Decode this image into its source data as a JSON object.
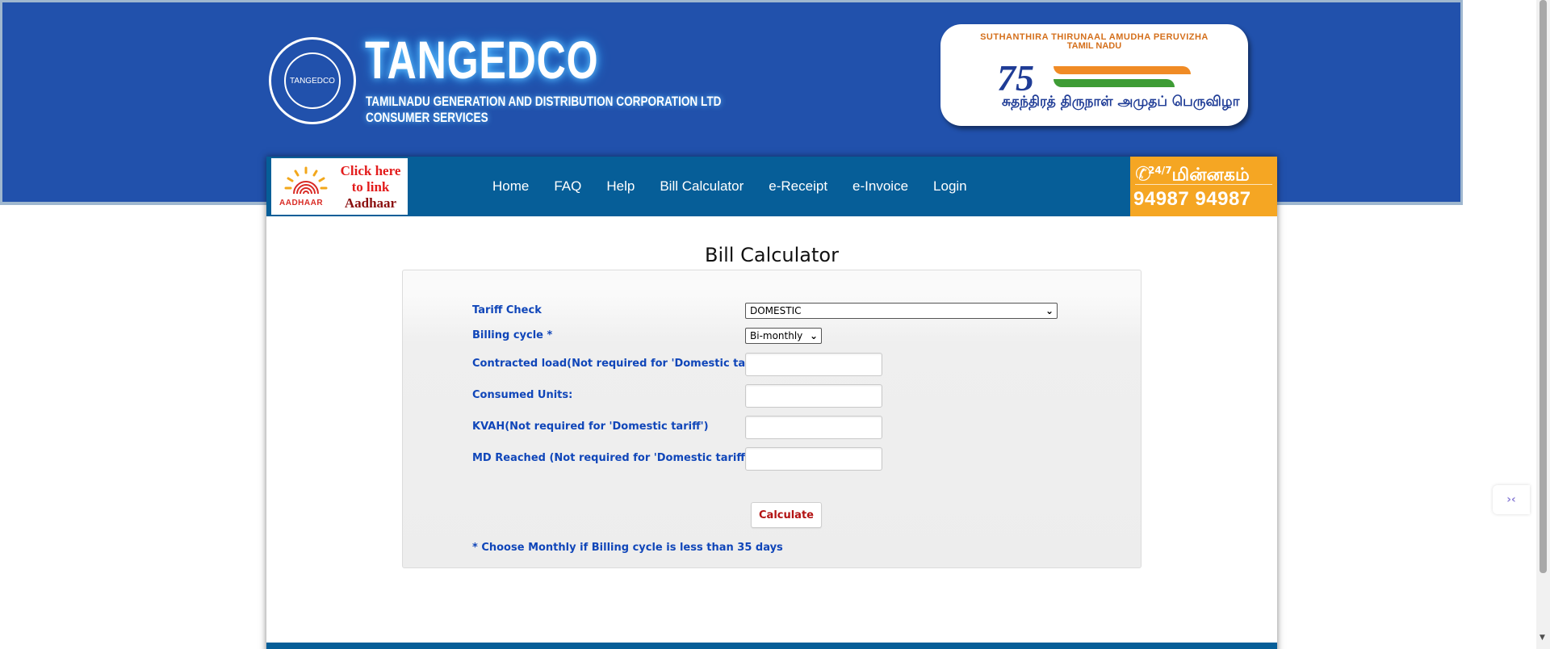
{
  "header": {
    "logo_text": "TANGEDCO",
    "brand_title": "TANGEDCO",
    "brand_subtitle_line1": "TAMILNADU GENERATION AND DISTRIBUTION CORPORATION LTD",
    "brand_subtitle_line2": "CONSUMER SERVICES",
    "festival": {
      "line1": "SUTHANTHIRA THIRUNAAL  AMUDHA PERUVIZHA",
      "line2": "TAMIL NADU",
      "number": "75",
      "tamil_text": "சுதந்திரத் திருநாள் அமுதப் பெருவிழா"
    }
  },
  "nav": {
    "aadhaar": {
      "logo_word": "AADHAAR",
      "line1": "Click here",
      "line2": "to link",
      "line3": "Aadhaar"
    },
    "items": [
      {
        "label": "Home"
      },
      {
        "label": "FAQ"
      },
      {
        "label": "Help"
      },
      {
        "label": "Bill Calculator"
      },
      {
        "label": "e-Receipt"
      },
      {
        "label": "e-Invoice"
      },
      {
        "label": "Login"
      }
    ],
    "helpline": {
      "badge": "24/7",
      "tamil": "மின்னகம்",
      "number": "94987 94987"
    }
  },
  "form": {
    "title": "Bill Calculator",
    "tariff_label": "Tariff Check",
    "tariff_value": "DOMESTIC",
    "billing_label": "Billing cycle *",
    "billing_value": "Bi-monthly",
    "contracted_label": "Contracted load(Not required for 'Domestic tariff')",
    "contracted_value": "",
    "units_label": "Consumed Units:",
    "units_value": "",
    "kvah_label": "KVAH(Not required for 'Domestic tariff')",
    "kvah_value": "",
    "md_label": "MD Reached (Not required for 'Domestic tariff')",
    "md_value": "",
    "calculate_label": "Calculate",
    "note": "* Choose Monthly if Billing cycle is less than 35 days"
  },
  "colors": {
    "header_blue": "#2151ac",
    "nav_blue": "#065e98",
    "helpline_orange": "#f5a623",
    "label_blue": "#1046b9",
    "button_red": "#b31313"
  }
}
